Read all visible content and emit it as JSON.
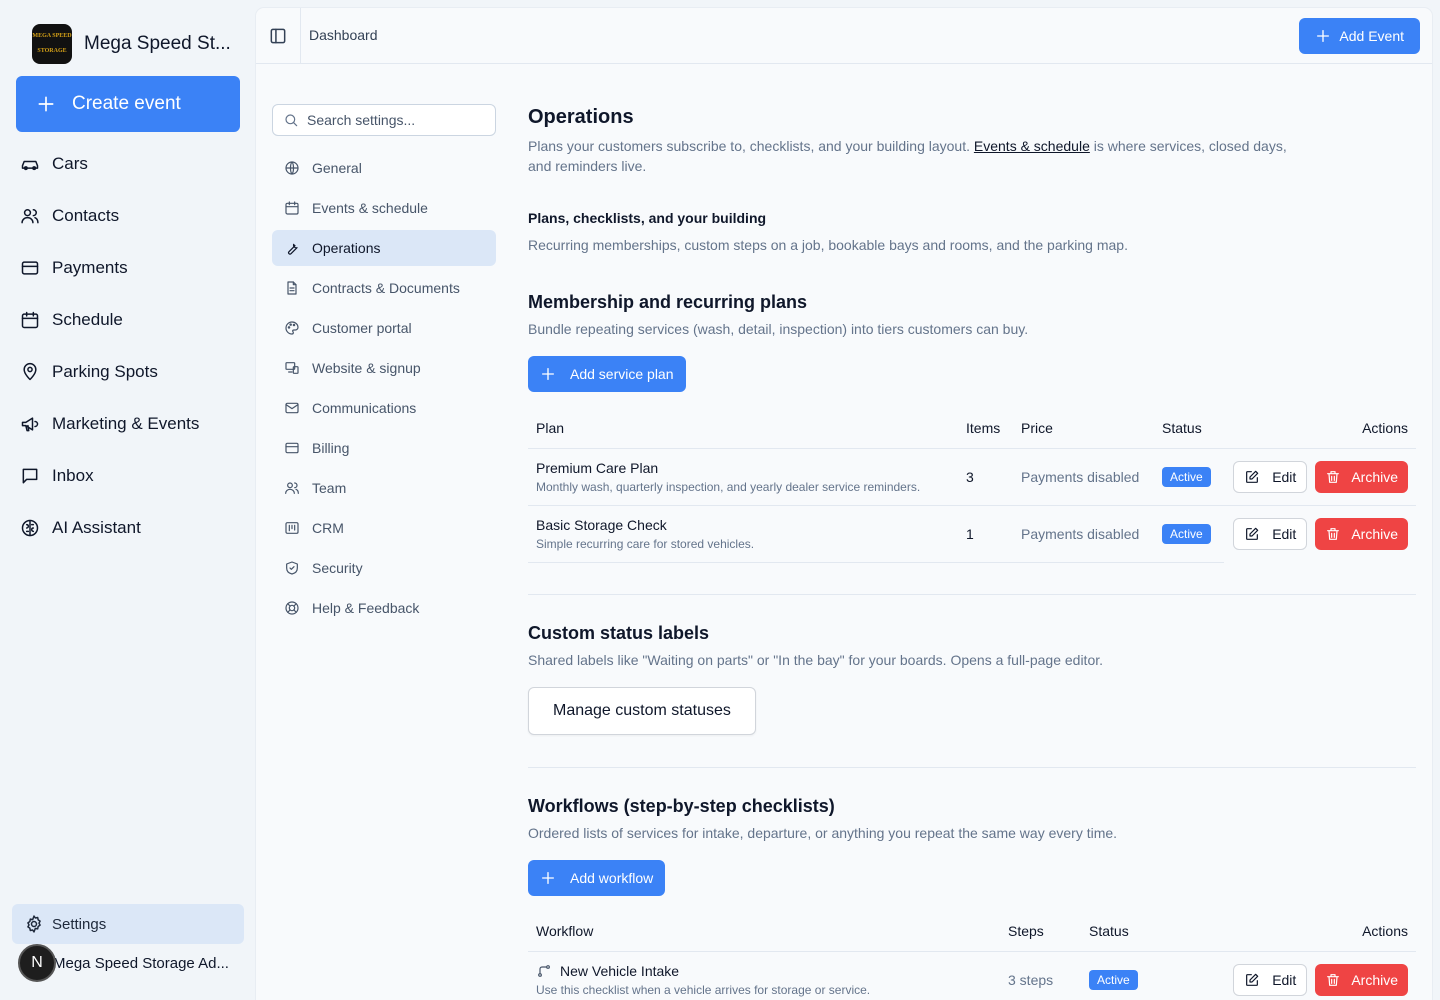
{
  "brand": {
    "name": "Mega Speed St...",
    "logo_text": [
      "MEGA SPEED",
      "STORAGE"
    ]
  },
  "sidebar": {
    "create_label": "Create event",
    "items": [
      {
        "label": "Cars",
        "icon": "car-icon"
      },
      {
        "label": "Contacts",
        "icon": "users-icon"
      },
      {
        "label": "Payments",
        "icon": "credit-card-icon"
      },
      {
        "label": "Schedule",
        "icon": "calendar-icon"
      },
      {
        "label": "Parking Spots",
        "icon": "map-pin-icon"
      },
      {
        "label": "Marketing & Events",
        "icon": "megaphone-icon"
      },
      {
        "label": "Inbox",
        "icon": "message-square-icon"
      },
      {
        "label": "AI Assistant",
        "icon": "brain-icon"
      }
    ],
    "settings_label": "Settings",
    "account": {
      "initial": "N",
      "name": "Mega Speed Storage Ad..."
    }
  },
  "topbar": {
    "breadcrumb": "Dashboard",
    "add_event_label": "Add Event"
  },
  "settings_nav": {
    "search_placeholder": "Search settings...",
    "items": [
      {
        "label": "General",
        "icon": "globe-icon"
      },
      {
        "label": "Events & schedule",
        "icon": "calendar-icon"
      },
      {
        "label": "Operations",
        "icon": "wrench-icon",
        "active": true
      },
      {
        "label": "Contracts & Documents",
        "icon": "file-text-icon"
      },
      {
        "label": "Customer portal",
        "icon": "palette-icon"
      },
      {
        "label": "Website & signup",
        "icon": "monitor-icon"
      },
      {
        "label": "Communications",
        "icon": "mail-icon"
      },
      {
        "label": "Billing",
        "icon": "credit-card-icon"
      },
      {
        "label": "Team",
        "icon": "users-icon"
      },
      {
        "label": "CRM",
        "icon": "columns-icon"
      },
      {
        "label": "Security",
        "icon": "shield-icon"
      },
      {
        "label": "Help & Feedback",
        "icon": "lifebuoy-icon"
      }
    ]
  },
  "content": {
    "title": "Operations",
    "intro_before": "Plans your customers subscribe to, checklists, and your building layout. ",
    "intro_link": "Events & schedule",
    "intro_after": " is where services, closed days, and reminders live.",
    "section_heading": "Plans, checklists, and your building",
    "section_desc": "Recurring memberships, custom steps on a job, bookable bays and rooms, and the parking map.",
    "plans": {
      "title": "Membership and recurring plans",
      "desc": "Bundle repeating services (wash, detail, inspection) into tiers customers can buy.",
      "add_label": "Add service plan",
      "columns": [
        "Plan",
        "Items",
        "Price",
        "Status",
        "Actions"
      ],
      "rows": [
        {
          "name": "Premium Care Plan",
          "desc": "Monthly wash, quarterly inspection, and yearly dealer service reminders.",
          "items": "3",
          "price": "Payments disabled",
          "status": "Active"
        },
        {
          "name": "Basic Storage Check",
          "desc": "Simple recurring care for stored vehicles.",
          "items": "1",
          "price": "Payments disabled",
          "status": "Active"
        }
      ],
      "edit_label": "Edit",
      "archive_label": "Archive"
    },
    "statuses": {
      "title": "Custom status labels",
      "desc": "Shared labels like \"Waiting on parts\" or \"In the bay\" for your boards. Opens a full-page editor.",
      "button_label": "Manage custom statuses"
    },
    "workflows": {
      "title": "Workflows (step-by-step checklists)",
      "desc": "Ordered lists of services for intake, departure, or anything you repeat the same way every time.",
      "add_label": "Add workflow",
      "columns": [
        "Workflow",
        "Steps",
        "Status",
        "Actions"
      ],
      "rows": [
        {
          "name": "New Vehicle Intake",
          "desc": "Use this checklist when a vehicle arrives for storage or service.",
          "steps": "3 steps",
          "status": "Active"
        }
      ],
      "edit_label": "Edit",
      "archive_label": "Archive"
    }
  },
  "colors": {
    "primary": "#3b82f6",
    "danger": "#ef4444",
    "active_nav": "#dbe7f7"
  }
}
